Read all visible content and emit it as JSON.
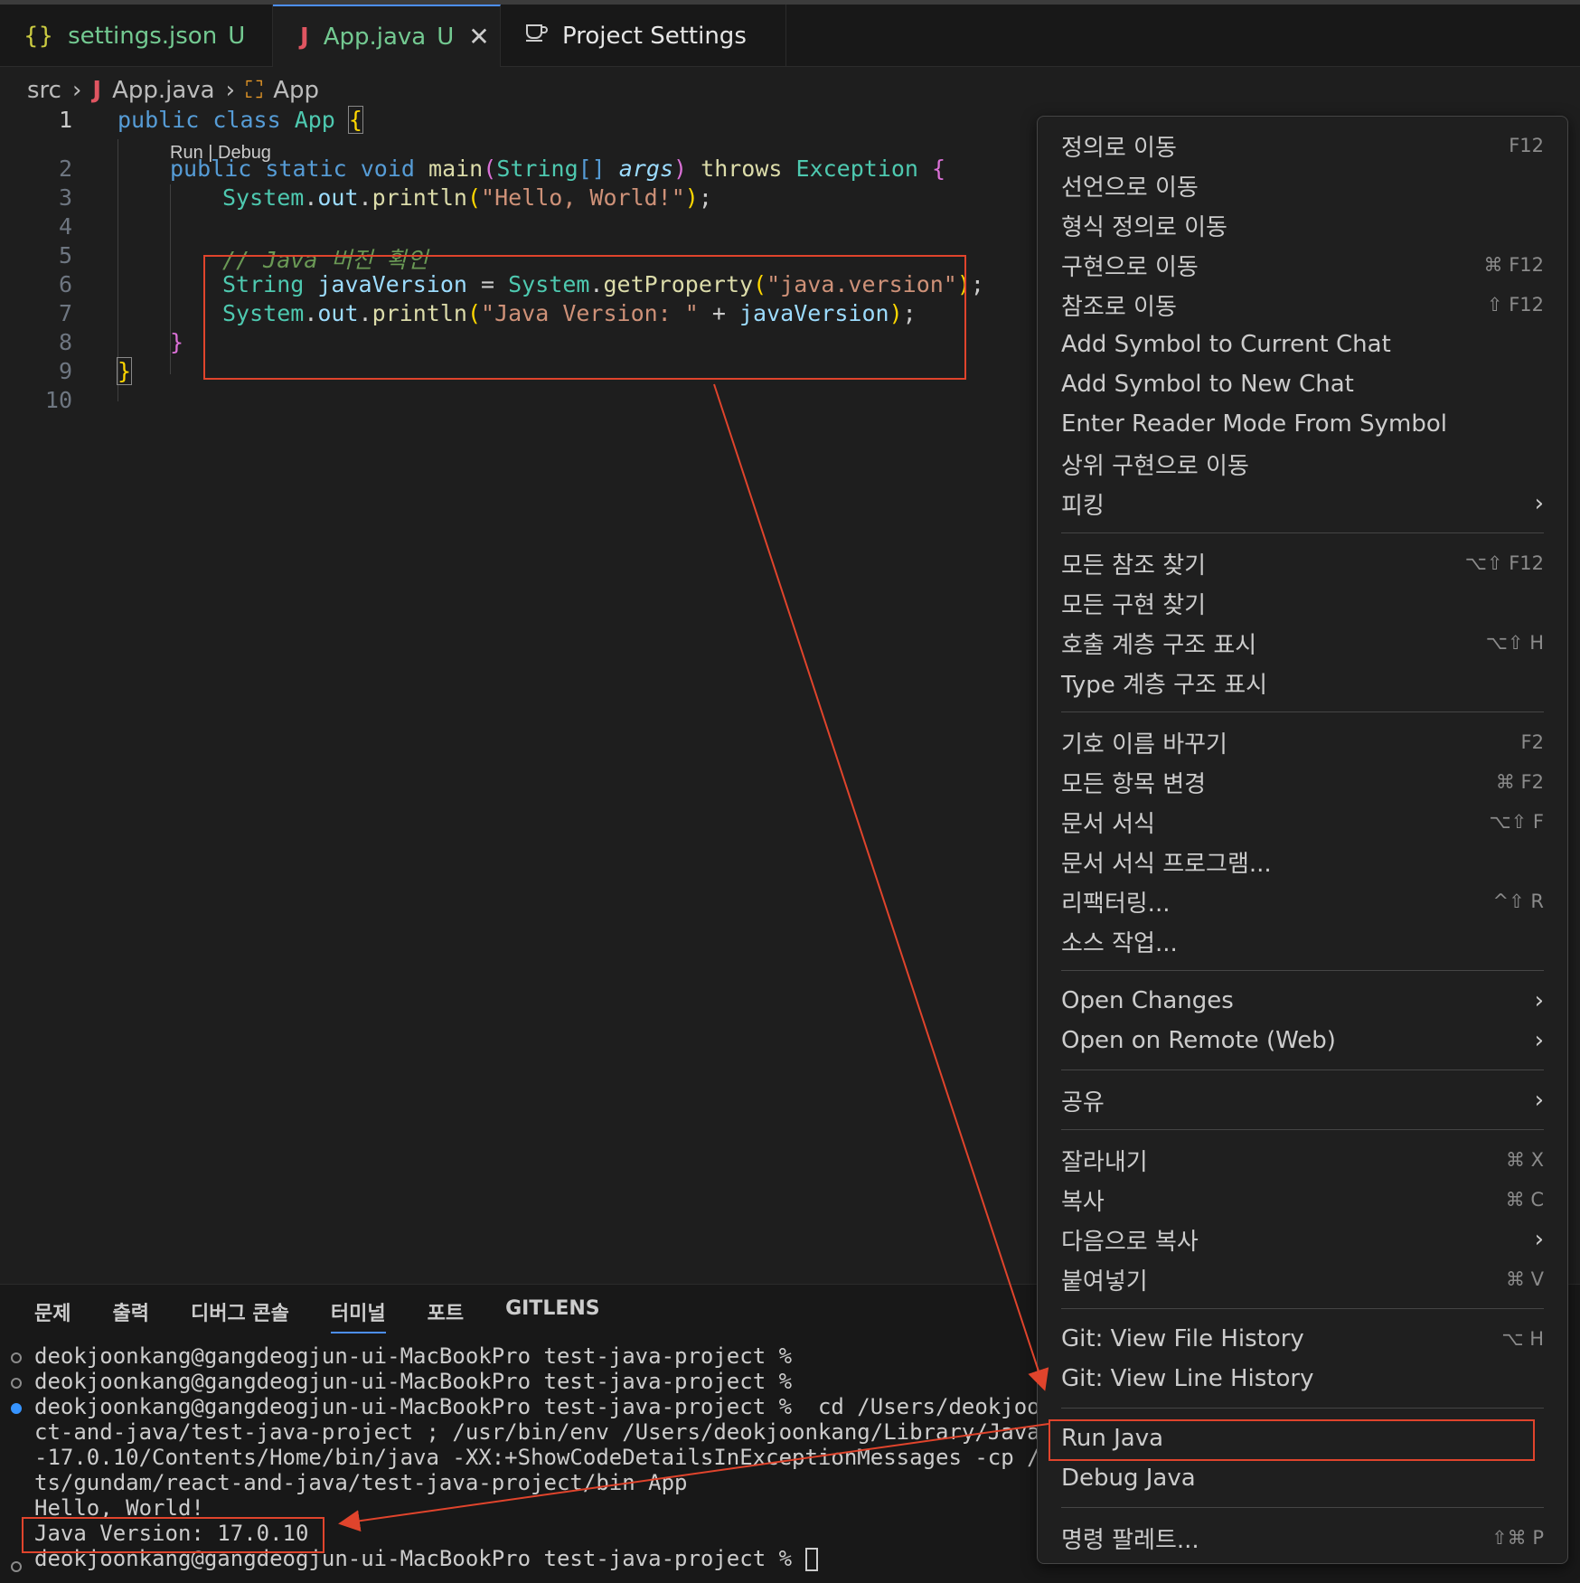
{
  "tabs": [
    {
      "icon": "{}",
      "label": "settings.json",
      "status": "U"
    },
    {
      "icon": "J",
      "label": "App.java",
      "status": "U"
    },
    {
      "label": "Project Settings"
    }
  ],
  "breadcrumb": {
    "folder": "src",
    "file": "App.java",
    "symbol": "App"
  },
  "editor": {
    "line_numbers": [
      "1",
      "2",
      "3",
      "4",
      "5",
      "6",
      "7",
      "8",
      "9",
      "10"
    ],
    "codelens": "Run | Debug"
  },
  "panel": {
    "tabs": [
      "문제",
      "출력",
      "디버그 콘솔",
      "터미널",
      "포트",
      "GITLENS"
    ],
    "terminal_lines": [
      "deokjoonkang@gangdeogjun-ui-MacBookPro test-java-project %",
      "deokjoonkang@gangdeogjun-ui-MacBookPro test-java-project %",
      "deokjoonkang@gangdeogjun-ui-MacBookPro test-java-project %  cd /Users/deokjoonk",
      "ct-and-java/test-java-project ; /usr/bin/env /Users/deokjoonkang/Library/Java/J",
      "-17.0.10/Contents/Home/bin/java -XX:+ShowCodeDetailsInExceptionMessages -cp /Us",
      "ts/gundam/react-and-java/test-java-project/bin App",
      "Hello, World!",
      "Java Version: 17.0.10",
      "deokjoonkang@gangdeogjun-ui-MacBookPro test-java-project % "
    ]
  },
  "menu": {
    "items": [
      {
        "label": "정의로 이동",
        "kb": "F12"
      },
      {
        "label": "선언으로 이동",
        "kb": ""
      },
      {
        "label": "형식 정의로 이동",
        "kb": ""
      },
      {
        "label": "구현으로 이동",
        "kb": "⌘ F12"
      },
      {
        "label": "참조로 이동",
        "kb": "⇧ F12"
      },
      {
        "label": "Add Symbol to Current Chat",
        "kb": ""
      },
      {
        "label": "Add Symbol to New Chat",
        "kb": ""
      },
      {
        "label": "Enter Reader Mode From Symbol",
        "kb": ""
      },
      {
        "label": "상위 구현으로 이동",
        "kb": ""
      },
      {
        "label": "피킹",
        "kb": "",
        "submenu": true
      },
      {
        "label": "모든 참조 찾기",
        "kb": "⌥⇧ F12"
      },
      {
        "label": "모든 구현 찾기",
        "kb": ""
      },
      {
        "label": "호출 계층 구조 표시",
        "kb": "⌥⇧ H"
      },
      {
        "label": "Type 계층 구조 표시",
        "kb": ""
      },
      {
        "label": "기호 이름 바꾸기",
        "kb": "F2"
      },
      {
        "label": "모든 항목 변경",
        "kb": "⌘ F2"
      },
      {
        "label": "문서 서식",
        "kb": "⌥⇧ F"
      },
      {
        "label": "문서 서식 프로그램...",
        "kb": ""
      },
      {
        "label": "리팩터링...",
        "kb": "^⇧ R"
      },
      {
        "label": "소스 작업...",
        "kb": ""
      },
      {
        "label": "Open Changes",
        "kb": "",
        "submenu": true
      },
      {
        "label": "Open on Remote (Web)",
        "kb": "",
        "submenu": true
      },
      {
        "label": "공유",
        "kb": "",
        "submenu": true
      },
      {
        "label": "잘라내기",
        "kb": "⌘ X"
      },
      {
        "label": "복사",
        "kb": "⌘ C"
      },
      {
        "label": "다음으로 복사",
        "kb": "",
        "submenu": true
      },
      {
        "label": "붙여넣기",
        "kb": "⌘ V"
      },
      {
        "label": "Git: View File History",
        "kb": "⌥ H"
      },
      {
        "label": "Git: View Line History",
        "kb": ""
      },
      {
        "label": "Run Java",
        "kb": ""
      },
      {
        "label": "Debug Java",
        "kb": ""
      },
      {
        "label": "명령 팔레트...",
        "kb": "⇧⌘ P"
      }
    ],
    "submenu_glyph": "›"
  },
  "colors": {
    "annotation": "#e0442c",
    "accent": "#4c8ffb"
  }
}
